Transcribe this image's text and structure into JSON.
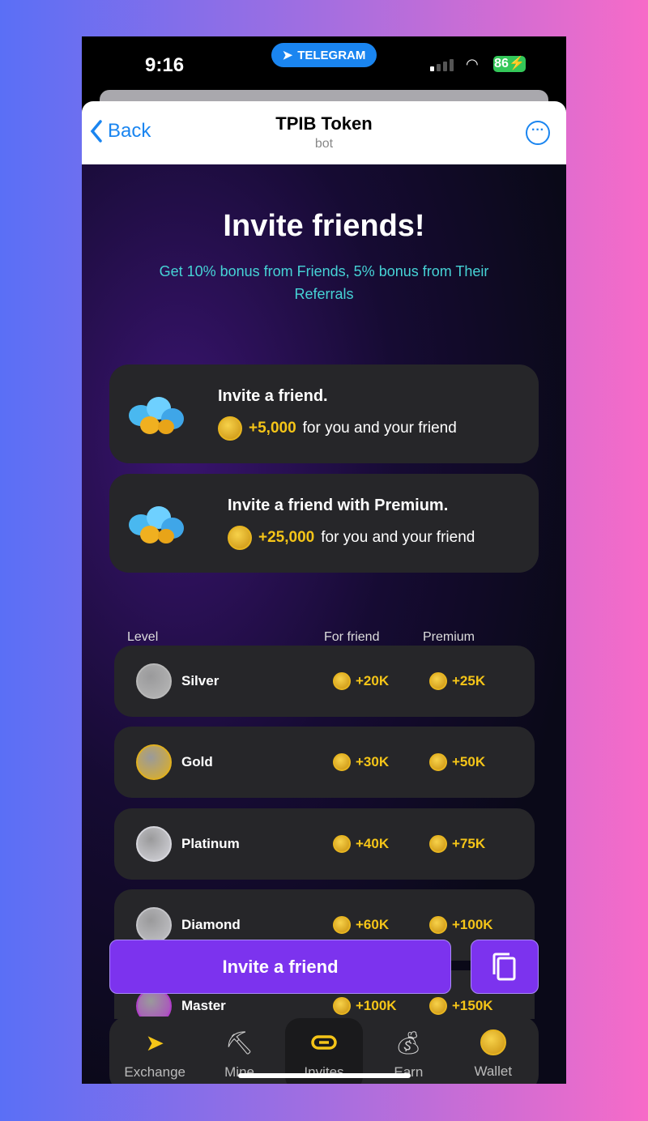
{
  "status": {
    "time": "9:16",
    "pill": "TELEGRAM",
    "battery": "86"
  },
  "header": {
    "back": "Back",
    "title": "TPIB Token",
    "subtitle": "bot"
  },
  "main": {
    "title": "Invite friends!",
    "subtitle": "Get 10% bonus from Friends, 5% bonus from Their Referrals",
    "cards": [
      {
        "title": "Invite a friend.",
        "amount": "+5,000",
        "text": "for you and your friend"
      },
      {
        "title": "Invite a friend with Premium.",
        "amount": "+25,000",
        "text": "for you and your friend"
      }
    ],
    "table": {
      "headers": [
        "Level",
        "For friend",
        "Premium"
      ],
      "rows": [
        {
          "level": "Silver",
          "friend": "+20K",
          "premium": "+25K",
          "color": "#b8b8b8"
        },
        {
          "level": "Gold",
          "friend": "+30K",
          "premium": "+50K",
          "color": "#e0b020"
        },
        {
          "level": "Platinum",
          "friend": "+40K",
          "premium": "+75K",
          "color": "#d6d6dc"
        },
        {
          "level": "Diamond",
          "friend": "+60K",
          "premium": "+100K",
          "color": "#c4c4c8"
        },
        {
          "level": "Master",
          "friend": "+100K",
          "premium": "+150K",
          "color": "#b040c8"
        }
      ]
    },
    "invite_button": "Invite a friend",
    "copy_icon": "copy-icon"
  },
  "nav": [
    {
      "label": "Exchange",
      "icon": "paper-plane-icon"
    },
    {
      "label": "Mine",
      "icon": "pickaxe-icon"
    },
    {
      "label": "Invites",
      "icon": "link-icon",
      "active": true
    },
    {
      "label": "Earn",
      "icon": "money-bag-icon"
    },
    {
      "label": "Wallet",
      "icon": "coin-icon"
    }
  ],
  "colors": {
    "accent": "#7c33ee",
    "gold": "#f5c518",
    "teal": "#46d3d6",
    "telegram": "#1a85f0"
  }
}
